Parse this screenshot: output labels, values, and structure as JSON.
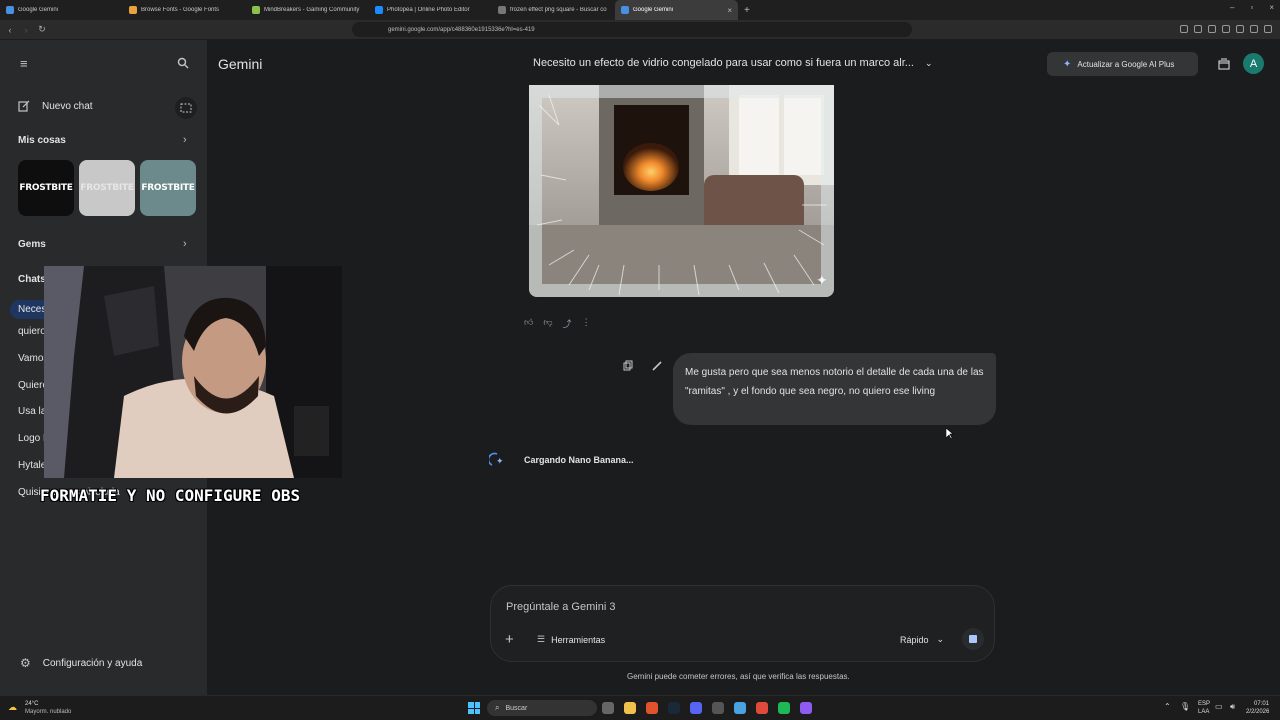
{
  "browser": {
    "tabs": [
      {
        "label": "Google Gemini",
        "active": false,
        "color": "#4a90e2"
      },
      {
        "label": "Browse Fonts - Google Fonts",
        "active": false,
        "color": "#e8a33c"
      },
      {
        "label": "MindBreakers - Gaming Community",
        "active": false,
        "color": "#8bc34a"
      },
      {
        "label": "Photopea | Online Photo Editor",
        "active": false,
        "color": "#1a8cff"
      },
      {
        "label": "frozen effect png square - Buscar co",
        "active": false,
        "color": "#777777"
      },
      {
        "label": "Google Gemini",
        "active": true,
        "color": "#4a90e2"
      }
    ],
    "url": "gemini.google.com/app/c488360e1915336e?hl=es-419"
  },
  "sidebar": {
    "new_chat": "Nuevo chat",
    "my_stuff": "Mis cosas",
    "thumbnails": [
      {
        "label": "FROSTBITE",
        "bg": "#0e0e0e",
        "fg": "#ffffff"
      },
      {
        "label": "FROSTBITE",
        "bg": "#c8c8c8",
        "fg": "#e6e6e6"
      },
      {
        "label": "FROSTBITE",
        "bg": "#6c8a8c",
        "fg": "#ffffff"
      }
    ],
    "gems": "Gems",
    "chats_heading": "Chats",
    "chat_items": [
      "Neces",
      "quiero",
      "Vamos",
      "Quiero",
      "Usa la",
      "Logo P",
      "Hytale",
      "Quisiera ... ps pixelada"
    ],
    "settings": "Configuración y ayuda"
  },
  "header": {
    "app_title": "Gemini",
    "conversation_title": "Necesito un efecto de vidrio congelado para usar como si fuera un marco alr...",
    "upgrade_label": "Actualizar a Google AI Plus",
    "avatar_letter": "A"
  },
  "conversation": {
    "user_message": "Me gusta pero que sea menos notorio el detalle de cada una de las \"ramitas\" , y el fondo que sea negro, no quiero ese living",
    "loading_text": "Cargando Nano Banana..."
  },
  "composer": {
    "placeholder": "Pregúntale a Gemini 3",
    "tools_label": "Herramientas",
    "mode_label": "Rápido"
  },
  "footer": {
    "disclaimer": "Gemini puede cometer errores, así que verifica las respuestas."
  },
  "overlay": {
    "caption": "FORMATIE Y NO CONFIGURE OBS"
  },
  "taskbar": {
    "weather_temp": "24°C",
    "weather_desc": "Mayorm. nublado",
    "search_label": "Buscar",
    "lang_top": "ESP",
    "lang_bottom": "LAA",
    "time": "07:01",
    "date": "2/2/2026"
  }
}
